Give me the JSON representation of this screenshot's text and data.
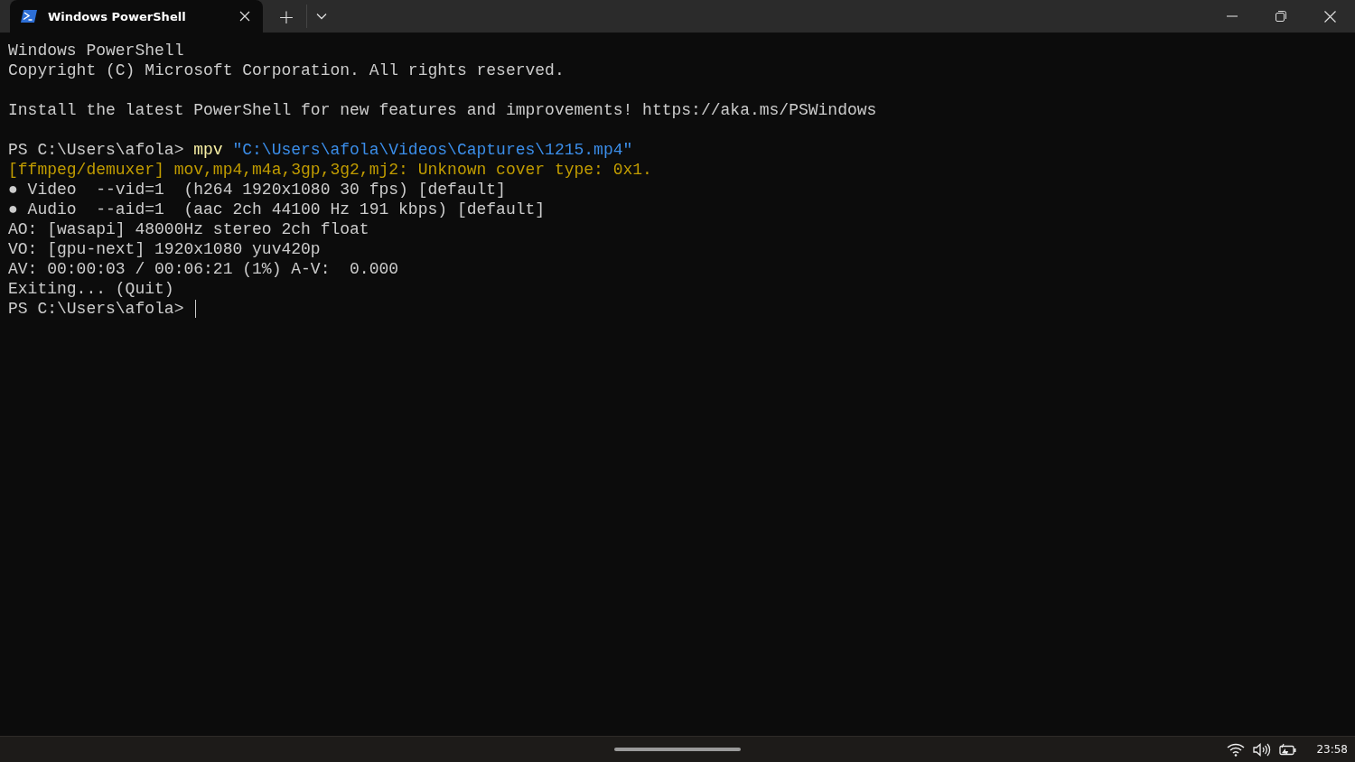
{
  "tabs": [
    {
      "title": "Windows PowerShell",
      "selected": true
    }
  ],
  "new_tab": "+",
  "blocks": [
    [
      {
        "segments": [
          {
            "kind": "plain",
            "text": "Windows PowerShell"
          }
        ]
      },
      {
        "segments": [
          {
            "kind": "plain",
            "text": "Copyright (C) Microsoft Corporation. All rights reserved."
          }
        ]
      }
    ],
    [
      {
        "segments": [
          {
            "kind": "plain",
            "text": "Install the latest PowerShell for new features and improvements! https://aka.ms/PSWindows"
          }
        ]
      }
    ],
    [
      {
        "segments": [
          {
            "kind": "plain",
            "text": "PS C:\\Users\\afola> "
          },
          {
            "kind": "command",
            "text": "mpv"
          },
          {
            "kind": "string",
            "text": " \"C:\\Users\\afola\\Videos\\Captures\\1215.mp4\""
          }
        ]
      },
      {
        "segments": [
          {
            "kind": "warning",
            "text": "[ffmpeg/demuxer] mov,mp4,m4a,3gp,3g2,mj2: Unknown cover type: 0x1."
          }
        ]
      },
      {
        "segments": [
          {
            "kind": "plain",
            "text": "● Video  --vid=1  (h264 1920x1080 30 fps) [default]"
          }
        ]
      },
      {
        "segments": [
          {
            "kind": "plain",
            "text": "● Audio  --aid=1  (aac 2ch 44100 Hz 191 kbps) [default]"
          }
        ]
      },
      {
        "segments": [
          {
            "kind": "plain",
            "text": "AO: [wasapi] 48000Hz stereo 2ch float"
          }
        ]
      },
      {
        "segments": [
          {
            "kind": "plain",
            "text": "VO: [gpu-next] 1920x1080 yuv420p"
          }
        ]
      },
      {
        "segments": [
          {
            "kind": "plain",
            "text": "AV: 00:00:03 / 00:06:21 (1%) A-V:  0.000"
          }
        ]
      },
      {
        "segments": [
          {
            "kind": "plain",
            "text": "Exiting... (Quit)"
          }
        ]
      },
      {
        "segments": [
          {
            "kind": "plain",
            "text": "PS C:\\Users\\afola> "
          }
        ],
        "cursor": true
      }
    ]
  ],
  "taskbar": {
    "clock": "23:58"
  }
}
